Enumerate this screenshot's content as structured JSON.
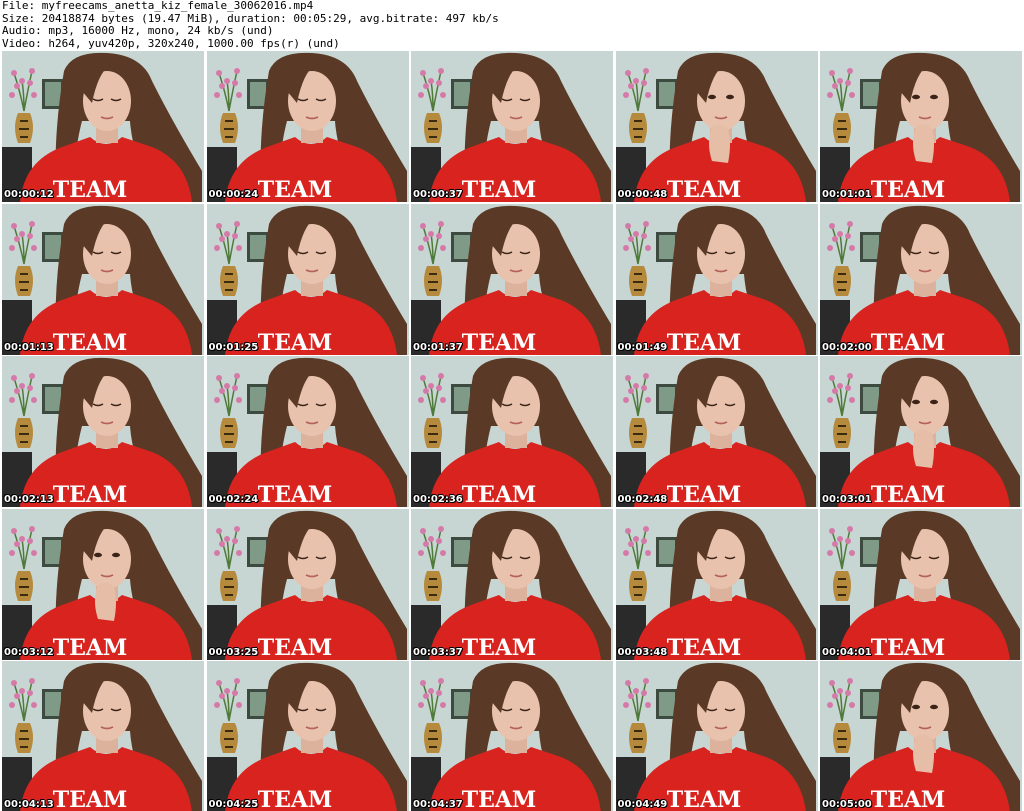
{
  "info": {
    "file": "File: myfreecams_anetta_kiz_female_30062016.mp4",
    "size": "Size: 20418874 bytes (19.47 MiB), duration: 00:05:29, avg.bitrate: 497 kb/s",
    "audio": "Audio: mp3, 16000 Hz, mono, 24 kb/s (und)",
    "video": "Video: h264, yuv420p, 320x240, 1000.00 fps(r) (und)"
  },
  "shirt_text": "TEAM",
  "colors": {
    "wall": "#c7d6d2",
    "shirt": "#d8231f",
    "hair": "#5a3a26",
    "skin": "#e8c2ad",
    "furniture": "#2a2a2a"
  },
  "thumbnails": [
    {
      "timestamp": "00:00:12",
      "pose": "down"
    },
    {
      "timestamp": "00:00:24",
      "pose": "down"
    },
    {
      "timestamp": "00:00:37",
      "pose": "down"
    },
    {
      "timestamp": "00:00:48",
      "pose": "hand"
    },
    {
      "timestamp": "00:01:01",
      "pose": "hand"
    },
    {
      "timestamp": "00:01:13",
      "pose": "down"
    },
    {
      "timestamp": "00:01:25",
      "pose": "down"
    },
    {
      "timestamp": "00:01:37",
      "pose": "down"
    },
    {
      "timestamp": "00:01:49",
      "pose": "down"
    },
    {
      "timestamp": "00:02:00",
      "pose": "down"
    },
    {
      "timestamp": "00:02:13",
      "pose": "down"
    },
    {
      "timestamp": "00:02:24",
      "pose": "down"
    },
    {
      "timestamp": "00:02:36",
      "pose": "down"
    },
    {
      "timestamp": "00:02:48",
      "pose": "down"
    },
    {
      "timestamp": "00:03:01",
      "pose": "hand"
    },
    {
      "timestamp": "00:03:12",
      "pose": "hand"
    },
    {
      "timestamp": "00:03:25",
      "pose": "down"
    },
    {
      "timestamp": "00:03:37",
      "pose": "down"
    },
    {
      "timestamp": "00:03:48",
      "pose": "down"
    },
    {
      "timestamp": "00:04:01",
      "pose": "down"
    },
    {
      "timestamp": "00:04:13",
      "pose": "down"
    },
    {
      "timestamp": "00:04:25",
      "pose": "down"
    },
    {
      "timestamp": "00:04:37",
      "pose": "down"
    },
    {
      "timestamp": "00:04:49",
      "pose": "down"
    },
    {
      "timestamp": "00:05:00",
      "pose": "hand"
    }
  ]
}
